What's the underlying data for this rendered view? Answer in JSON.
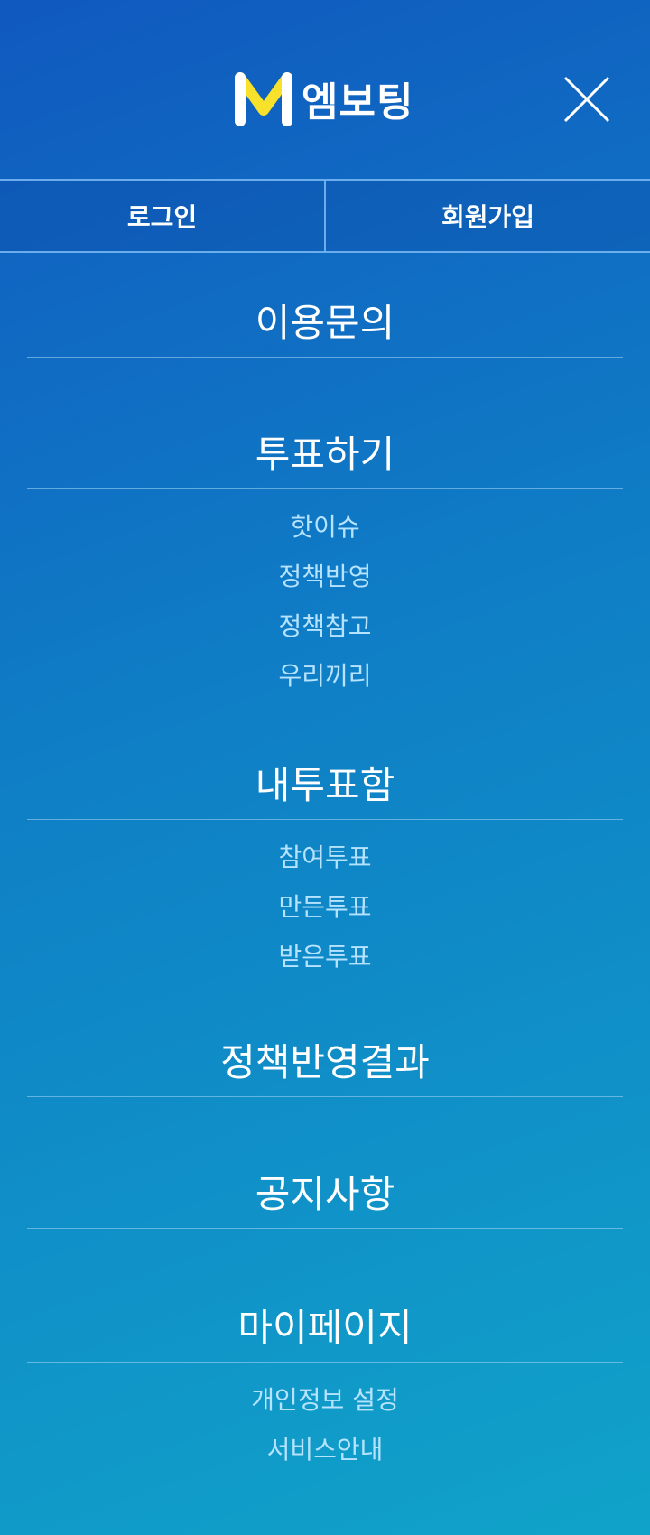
{
  "header": {
    "brand_name": "엠보팅",
    "brand_mark": "M",
    "close_icon": "close-x-icon",
    "colors": {
      "logo_mark_yellow": "#f8e12a",
      "logo_mark_white": "#ffffff"
    }
  },
  "auth": {
    "login_label": "로그인",
    "signup_label": "회원가입"
  },
  "menu": {
    "inquiry": {
      "title": "이용문의"
    },
    "vote": {
      "title": "투표하기",
      "items": [
        "핫이슈",
        "정책반영",
        "정책참고",
        "우리끼리"
      ]
    },
    "my_votes": {
      "title": "내투표함",
      "items": [
        "참여투표",
        "만든투표",
        "받은투표"
      ]
    },
    "policy_results": {
      "title": "정책반영결과"
    },
    "notice": {
      "title": "공지사항"
    },
    "my_page": {
      "title": "마이페이지",
      "items": [
        "개인정보 설정",
        "서비스안내"
      ]
    }
  },
  "colors": {
    "background_top": "#1059bf",
    "background_bottom": "#10a3c9",
    "sub_item_text": "#b6e3ff"
  }
}
